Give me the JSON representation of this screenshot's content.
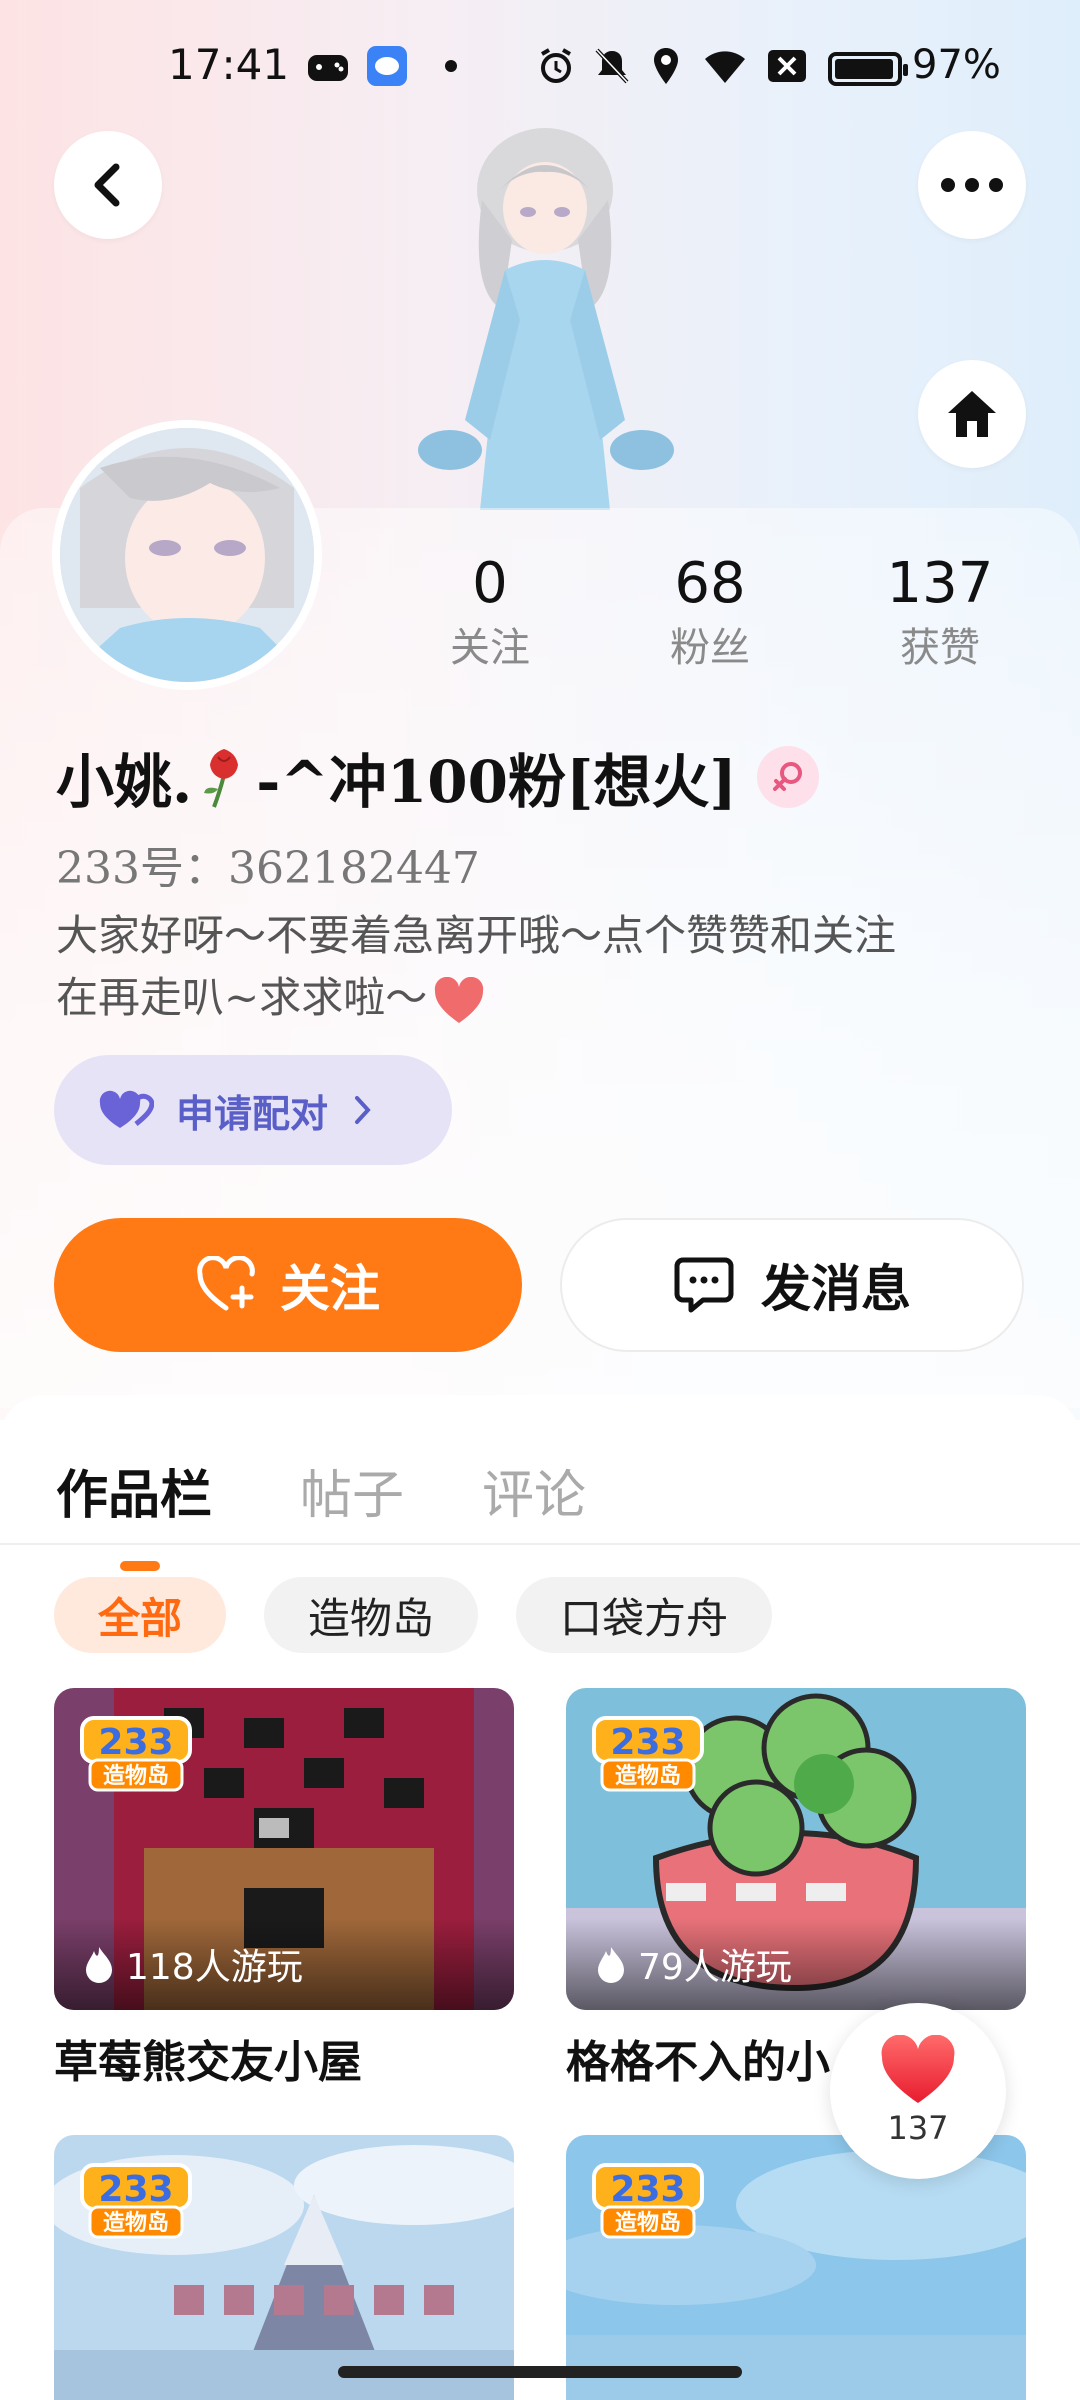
{
  "status_bar": {
    "time": "17:41",
    "battery_percent": "97%",
    "battery_level": 0.97,
    "icons": [
      "game-controller-icon",
      "chat-app-icon",
      "dot-icon",
      "alarm-icon",
      "mute-icon",
      "location-icon",
      "wifi-icon",
      "sim-off-icon",
      "battery-icon"
    ]
  },
  "header": {
    "back_icon": "chevron-left-icon",
    "more_icon": "more-dots-icon",
    "home_icon": "home-icon"
  },
  "profile": {
    "nickname_part1": "小姚.",
    "nickname_part2": "-^冲100粉[想火]",
    "uid": "233号：362182447",
    "bio_line1": "大家好呀～不要着急离开哦～点个赞赞和关注",
    "bio_line2": "在再走叭~求求啦～",
    "gender": "female",
    "stats": [
      {
        "value": "0",
        "label": "关注"
      },
      {
        "value": "68",
        "label": "粉丝"
      },
      {
        "value": "137",
        "label": "获赞"
      }
    ]
  },
  "actions": {
    "pair_label": "申请配对",
    "follow_label": "关注",
    "message_label": "发消息"
  },
  "tabs": [
    {
      "label": "作品栏",
      "active": true
    },
    {
      "label": "帖子",
      "active": false
    },
    {
      "label": "评论",
      "active": false
    }
  ],
  "filters": [
    {
      "label": "全部",
      "active": true
    },
    {
      "label": "造物岛",
      "active": false
    },
    {
      "label": "口袋方舟",
      "active": false
    }
  ],
  "works": [
    {
      "title": "草莓熊交友小屋",
      "plays": "118人游玩",
      "badge_text": "233",
      "badge_sub": "造物岛"
    },
    {
      "title": "格格不入的小",
      "plays": "79人游玩",
      "badge_text": "233",
      "badge_sub": "造物岛"
    },
    {
      "title": "",
      "plays": "",
      "badge_text": "233",
      "badge_sub": "造物岛"
    },
    {
      "title": "",
      "plays": "",
      "badge_text": "233",
      "badge_sub": "造物岛"
    }
  ],
  "floating_like": {
    "count": "137"
  },
  "colors": {
    "accent": "#ff7a15",
    "pair_bg": "#e6e3f7",
    "pair_text": "#5a5fc8",
    "chip_active_bg": "#ffe9dc"
  }
}
